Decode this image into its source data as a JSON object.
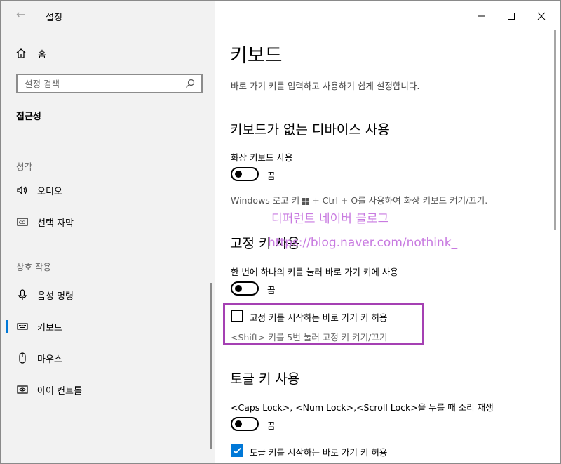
{
  "window": {
    "app_title": "설정",
    "back_glyph": "←",
    "minimize_icon": "minimize-icon",
    "maximize_icon": "maximize-icon",
    "close_icon": "close-icon"
  },
  "sidebar": {
    "home": {
      "label": "홈",
      "icon": "home-icon"
    },
    "search": {
      "placeholder": "설정 검색",
      "icon": "search-icon"
    },
    "section_title": "접근성",
    "groups": [
      {
        "label": "청각",
        "items": [
          {
            "label": "오디오",
            "icon": "speaker-icon"
          },
          {
            "label": "선택 자막",
            "icon": "closed-caption-icon"
          }
        ]
      },
      {
        "label": "상호 작용",
        "items": [
          {
            "label": "음성 명령",
            "icon": "microphone-icon"
          },
          {
            "label": "키보드",
            "icon": "keyboard-icon",
            "selected": true
          },
          {
            "label": "마우스",
            "icon": "mouse-icon"
          },
          {
            "label": "아이 컨트롤",
            "icon": "eye-control-icon"
          }
        ]
      }
    ]
  },
  "main": {
    "title": "키보드",
    "intro": "바로 가기 키를 입력하고 사용하기 쉽게 설정합니다.",
    "sections": [
      {
        "heading": "키보드가 없는 디바이스 사용",
        "setting_label": "화상 키보드 사용",
        "toggle_state": "끔",
        "hint_before": "Windows 로고 키",
        "hint_after": "+ Ctrl + O를 사용하여 화상 키보드 켜기/끄기."
      },
      {
        "heading": "고정 키 사용",
        "setting_label": "한 번에 하나의 키를 눌러 바로 가기 키에 사용",
        "toggle_state": "끔",
        "checkbox_label": "고정 키를 시작하는 바로 가기 키 허용",
        "checkbox_checked": false,
        "checkbox_hint": "<Shift> 키를 5번 눌러 고정 키 켜기/끄기"
      },
      {
        "heading": "토글 키 사용",
        "setting_label": "<Caps Lock>, <Num Lock>,<Scroll Lock>을 누를 때 소리 재생",
        "toggle_state": "끔",
        "checkbox_label": "토글 키를 시작하는 바로 가기 키 허용",
        "checkbox_checked": true
      }
    ]
  },
  "watermark": {
    "line1": "디퍼런트 네이버 블로그",
    "line2": "https://blog.naver.com/nothink_"
  },
  "colors": {
    "accent": "#0078d7",
    "highlight": "#a540b3",
    "watermark": "#c87ae0",
    "sidebar_bg": "#f2f2f2"
  }
}
